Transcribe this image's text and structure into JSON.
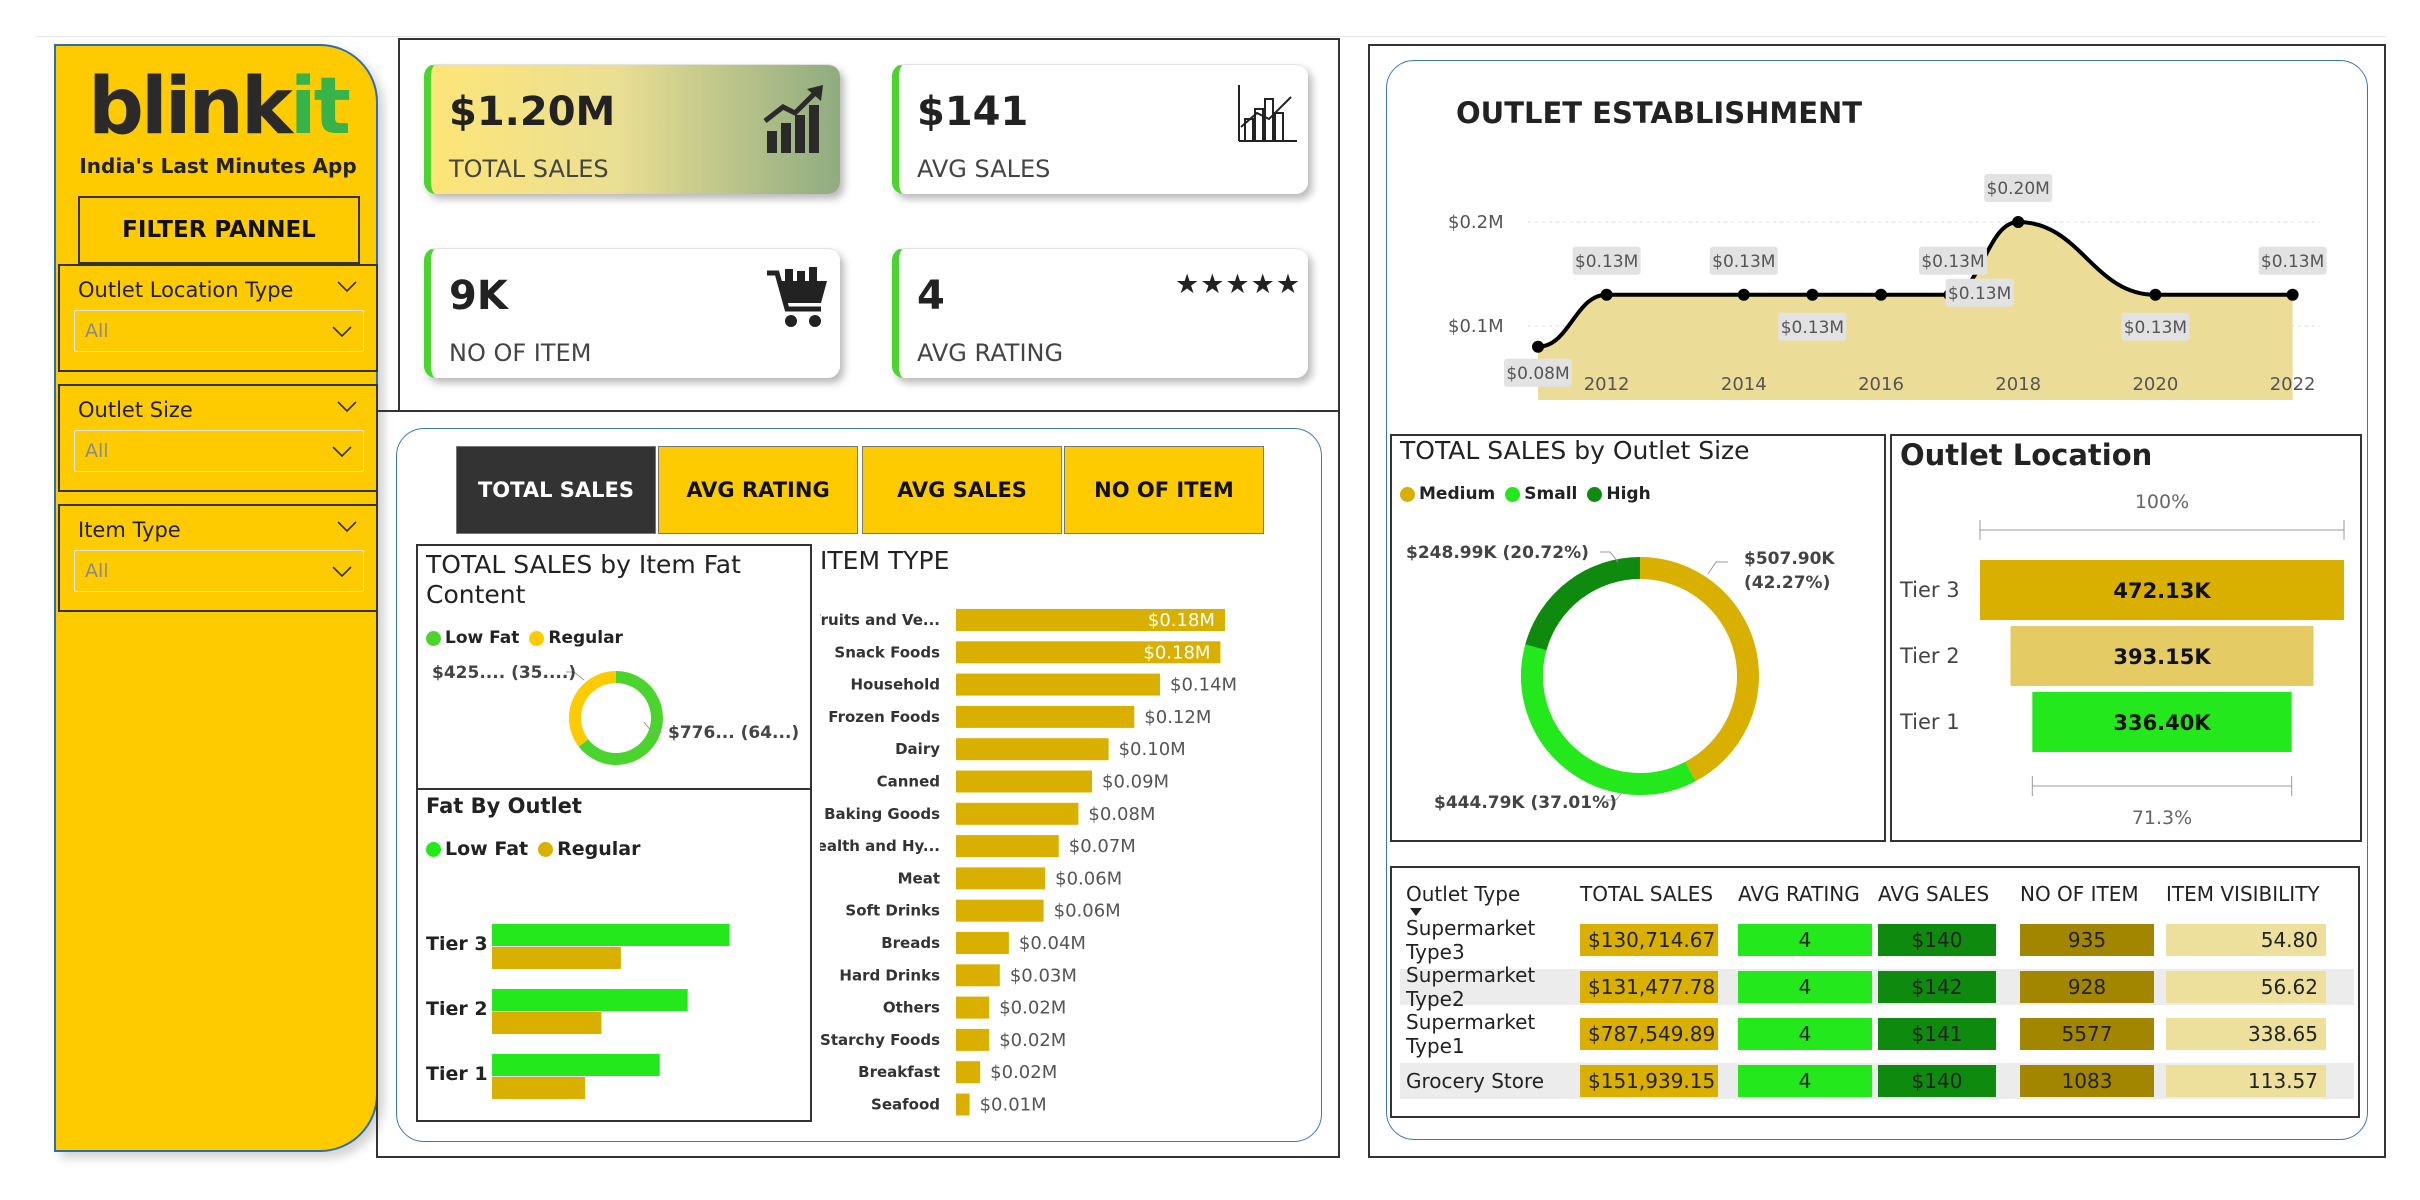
{
  "brand": {
    "logo_main": "blink",
    "logo_accent": "it",
    "tagline": "India's Last Minutes App"
  },
  "filter_panel": {
    "title": "FILTER PANNEL",
    "filters": [
      {
        "label": "Outlet Location Type",
        "value": "All"
      },
      {
        "label": "Outlet Size",
        "value": "All"
      },
      {
        "label": "Item Type",
        "value": "All"
      }
    ]
  },
  "kpis": {
    "total_sales": {
      "value": "$1.20M",
      "label": "TOTAL SALES",
      "icon": "chart-growth-icon"
    },
    "avg_sales": {
      "value": "$141",
      "label": "AVG SALES",
      "icon": "bar-chart-icon"
    },
    "no_of_item": {
      "value": "9K",
      "label": "NO OF ITEM",
      "icon": "shopping-cart-icon"
    },
    "avg_rating": {
      "value": "4",
      "label": "AVG RATING",
      "icon": "five-stars-icon",
      "stars": "★★★★★"
    }
  },
  "metric_tabs": [
    "TOTAL SALES",
    "AVG RATING",
    "AVG SALES",
    "NO OF ITEM"
  ],
  "colors": {
    "yellow": "#fecb00",
    "gold": "#d9b000",
    "green": "#22e81c",
    "dark_green": "#0e8a0e",
    "olive": "#a38600",
    "pale": "#ece09c",
    "area": "#ebdc98"
  },
  "chart_data": [
    {
      "type": "pie",
      "title": "TOTAL SALES by Item Fat Content",
      "legend": [
        "Low Fat",
        "Regular"
      ],
      "values": [
        776,
        425
      ],
      "labels": [
        "$776... (64...)",
        "$425.... (35....)"
      ]
    },
    {
      "type": "bar",
      "title": "Fat By Outlet",
      "legend": [
        "Low Fat",
        "Regular"
      ],
      "categories": [
        "Tier 3",
        "Tier 2",
        "Tier 1"
      ],
      "series": [
        {
          "name": "Low Fat",
          "values": [
            306,
            252,
            216
          ]
        },
        {
          "name": "Regular",
          "values": [
            166,
            141,
            120
          ]
        }
      ]
    },
    {
      "type": "bar",
      "title": "ITEM TYPE",
      "categories": [
        "Fruits and Ve...",
        "Snack Foods",
        "Household",
        "Frozen Foods",
        "Dairy",
        "Canned",
        "Baking Goods",
        "Health and Hy...",
        "Meat",
        "Soft Drinks",
        "Breads",
        "Hard Drinks",
        "Others",
        "Starchy Foods",
        "Breakfast",
        "Seafood"
      ],
      "values": [
        0.178,
        0.175,
        0.135,
        0.118,
        0.101,
        0.09,
        0.081,
        0.068,
        0.059,
        0.058,
        0.035,
        0.029,
        0.022,
        0.022,
        0.016,
        0.009
      ],
      "labels": [
        "$0.18M",
        "$0.18M",
        "$0.14M",
        "$0.12M",
        "$0.10M",
        "$0.09M",
        "$0.08M",
        "$0.07M",
        "$0.06M",
        "$0.06M",
        "$0.04M",
        "$0.03M",
        "$0.02M",
        "$0.02M",
        "$0.02M",
        "$0.01M"
      ]
    },
    {
      "type": "area",
      "title": "OUTLET ESTABLISHMENT",
      "x": [
        2011,
        2012,
        2014,
        2015,
        2016,
        2017,
        2018,
        2020,
        2022
      ],
      "y": [
        0.08,
        0.13,
        0.13,
        0.13,
        0.13,
        0.13,
        0.2,
        0.13,
        0.13
      ],
      "labels": [
        "$0.08M",
        "$0.13M",
        "$0.13M",
        "$0.13M",
        "$0.13M",
        "$0.13M",
        "$0.20M",
        "$0.13M",
        "$0.13M"
      ],
      "overlap_label": "$0.13M",
      "xticks": [
        "2012",
        "2014",
        "2016",
        "2018",
        "2020",
        "2022"
      ],
      "yticks": [
        "$0.2M",
        "$0.1M"
      ],
      "ylim": [
        0.06,
        0.22
      ]
    },
    {
      "type": "pie",
      "title": "TOTAL SALES by Outlet Size",
      "legend": [
        "Medium",
        "Small",
        "High"
      ],
      "values": [
        507.9,
        444.79,
        248.99
      ],
      "labels": [
        "$507.90K (42.27%)",
        "$444.79K (37.01%)",
        "$248.99K (20.72%)"
      ]
    },
    {
      "type": "bar",
      "title": "Outlet Location",
      "categories": [
        "Tier 3",
        "Tier 2",
        "Tier 1"
      ],
      "values": [
        472.13,
        393.15,
        336.4
      ],
      "labels": [
        "472.13K",
        "393.15K",
        "336.40K"
      ],
      "top_pct": "100%",
      "bottom_pct": "71.3%"
    }
  ],
  "outlet_table": {
    "columns": [
      "Outlet Type",
      "TOTAL SALES",
      "AVG RATING",
      "AVG SALES",
      "NO OF ITEM",
      "ITEM VISIBILITY"
    ],
    "rows": [
      [
        "Supermarket Type3",
        "$130,714.67",
        "4",
        "$140",
        "935",
        "54.80"
      ],
      [
        "Supermarket Type2",
        "$131,477.78",
        "4",
        "$142",
        "928",
        "56.62"
      ],
      [
        "Supermarket Type1",
        "$787,549.89",
        "4",
        "$141",
        "5577",
        "338.65"
      ],
      [
        "Grocery Store",
        "$151,939.15",
        "4",
        "$140",
        "1083",
        "113.57"
      ]
    ]
  }
}
